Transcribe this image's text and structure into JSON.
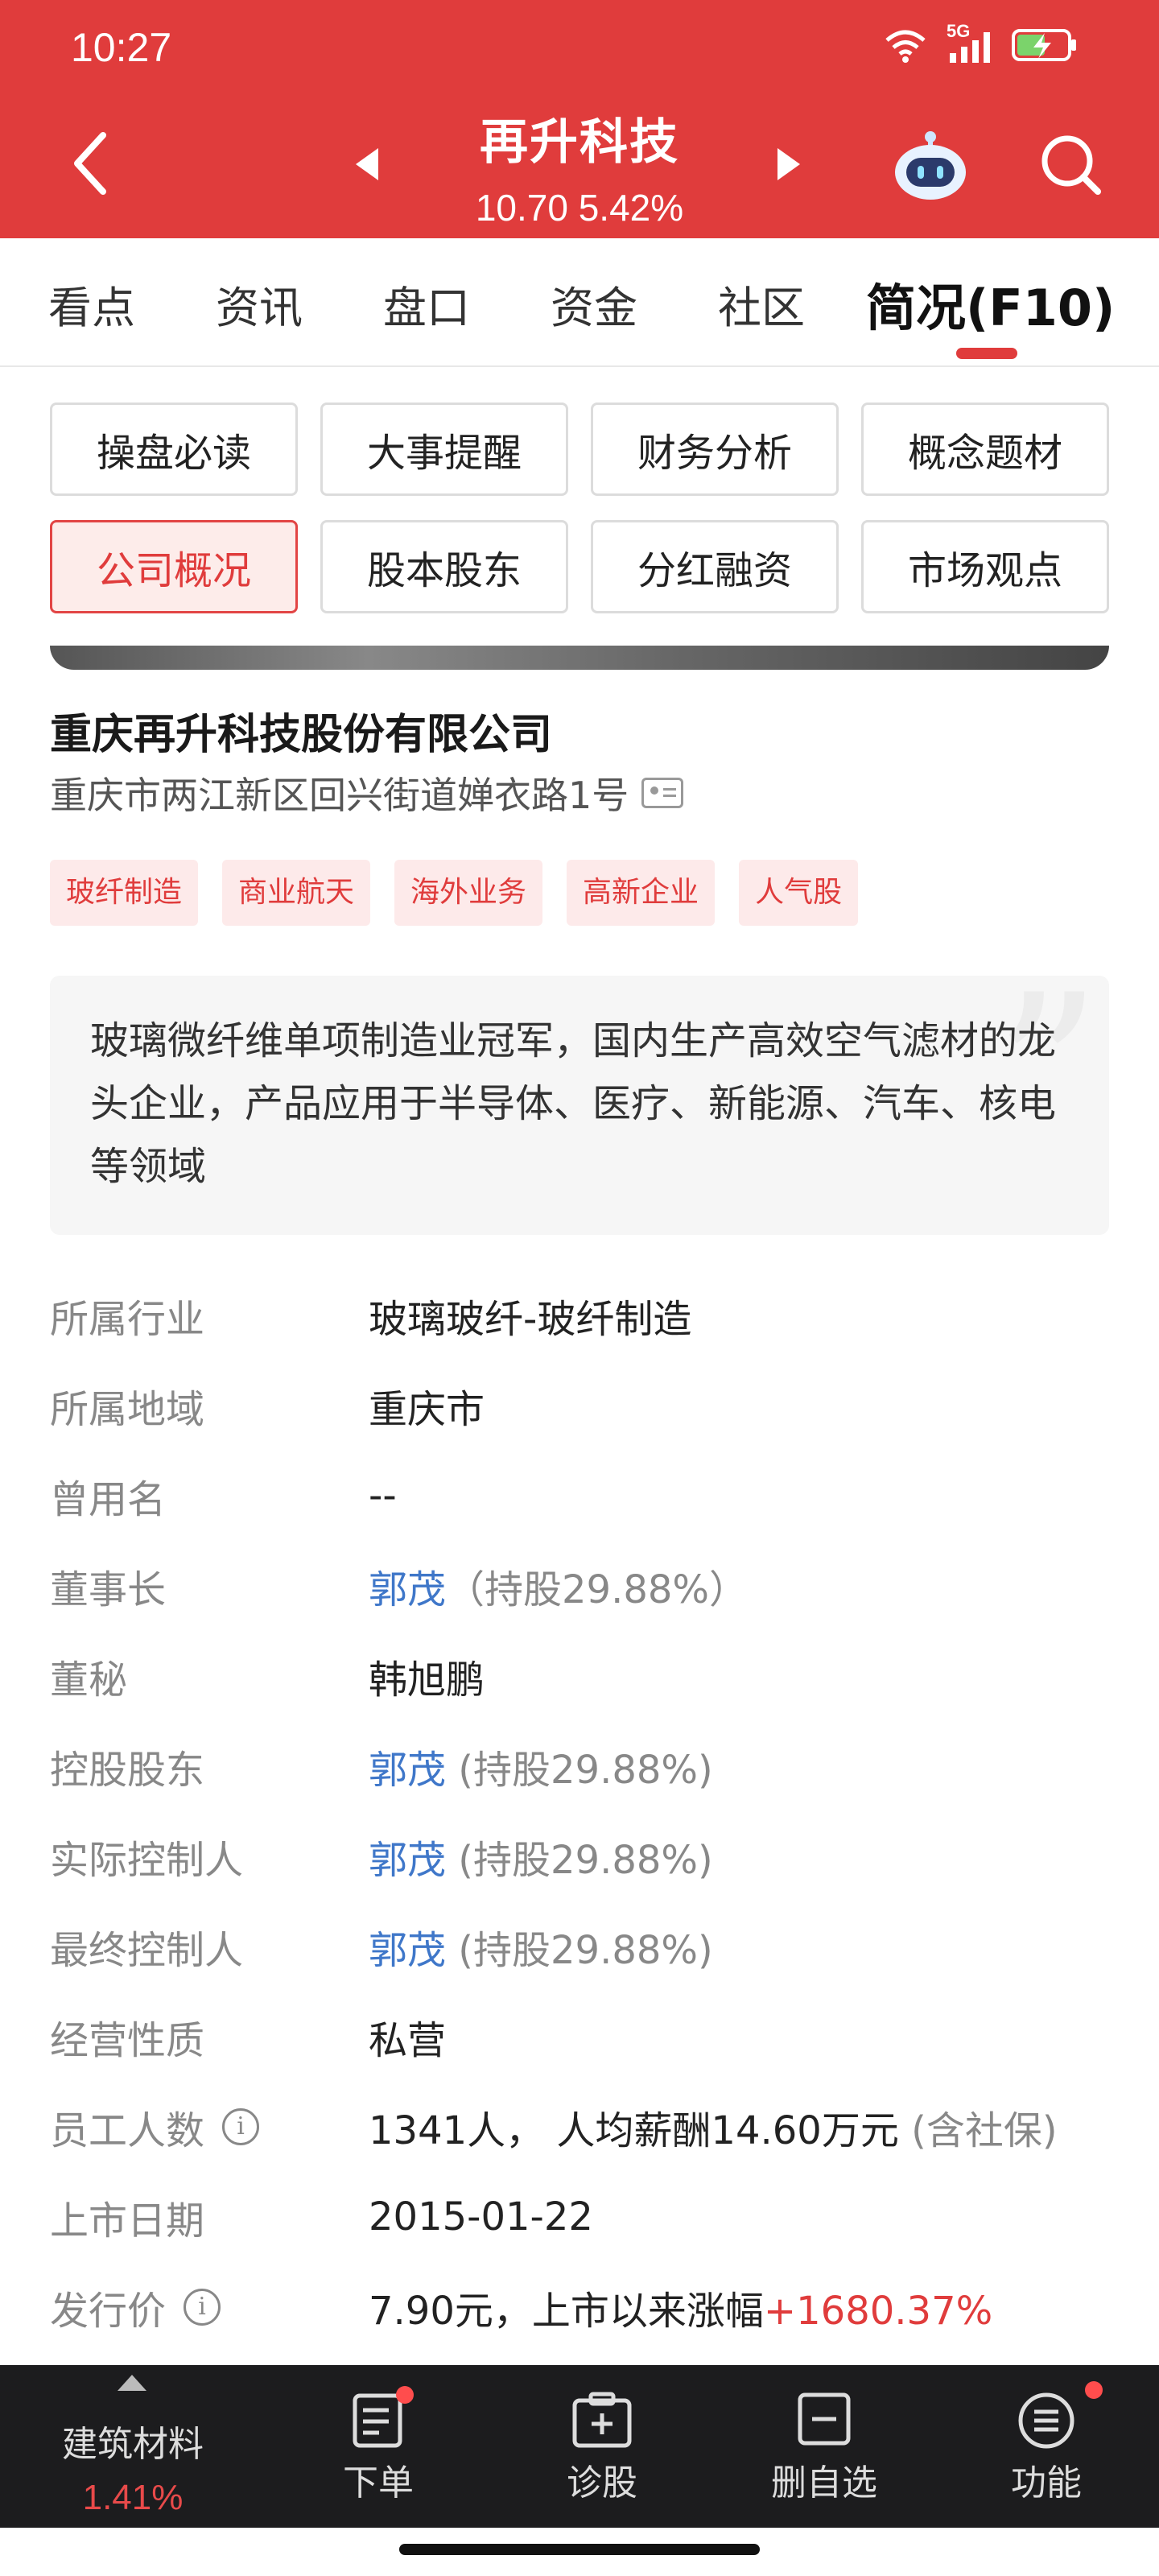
{
  "status_bar": {
    "time": "10:27",
    "network": "5G"
  },
  "header": {
    "stock_name": "再升科技",
    "price_line": "10.70  5.42%",
    "accent_color": "#e03c3c"
  },
  "tabs": [
    {
      "label": "看点"
    },
    {
      "label": "资讯"
    },
    {
      "label": "盘口"
    },
    {
      "label": "资金"
    },
    {
      "label": "社区"
    },
    {
      "label": "简况(F10)"
    }
  ],
  "sections": [
    {
      "label": "操盘必读"
    },
    {
      "label": "大事提醒"
    },
    {
      "label": "财务分析"
    },
    {
      "label": "概念题材"
    },
    {
      "label": "公司概况"
    },
    {
      "label": "股本股东"
    },
    {
      "label": "分红融资"
    },
    {
      "label": "市场观点"
    }
  ],
  "company": {
    "name": "重庆再升科技股份有限公司",
    "address": "重庆市两江新区回兴街道婵衣路1号",
    "tags": [
      "玻纤制造",
      "商业航天",
      "海外业务",
      "高新企业",
      "人气股"
    ],
    "summary": "玻璃微纤维单项制造业冠军，国内生产高效空气滤材的龙头企业，产品应用于半导体、医疗、新能源、汽车、核电等领域"
  },
  "info": {
    "industry_label": "所属行业",
    "industry": "玻璃玻纤-玻纤制造",
    "region_label": "所属地域",
    "region": "重庆市",
    "former_name_label": "曾用名",
    "former_name": "--",
    "chairman_label": "董事长",
    "chairman": "郭茂",
    "chairman_note": "（持股29.88%）",
    "secretary_label": "董秘",
    "secretary": "韩旭鹏",
    "controlling_label": "控股股东",
    "controlling": "郭茂",
    "controlling_note": "(持股29.88%)",
    "actual_label": "实际控制人",
    "actual": "郭茂",
    "actual_note": "(持股29.88%)",
    "ultimate_label": "最终控制人",
    "ultimate": "郭茂",
    "ultimate_note": "(持股29.88%)",
    "nature_label": "经营性质",
    "nature": "私营",
    "staff_label": "员工人数",
    "staff": "1341人， 人均薪酬14.60万元",
    "staff_note": "(含社保)",
    "listing_label": "上市日期",
    "listing": "2015-01-22",
    "ipo_label": "发行价",
    "ipo": "7.90元，上市以来涨幅",
    "ipo_change": "+1680.37%"
  },
  "bottom_bar": {
    "sector_name": "建筑材料",
    "sector_change": "1.41%",
    "order": "下单",
    "diagnose": "诊股",
    "remove": "删自选",
    "functions": "功能"
  }
}
